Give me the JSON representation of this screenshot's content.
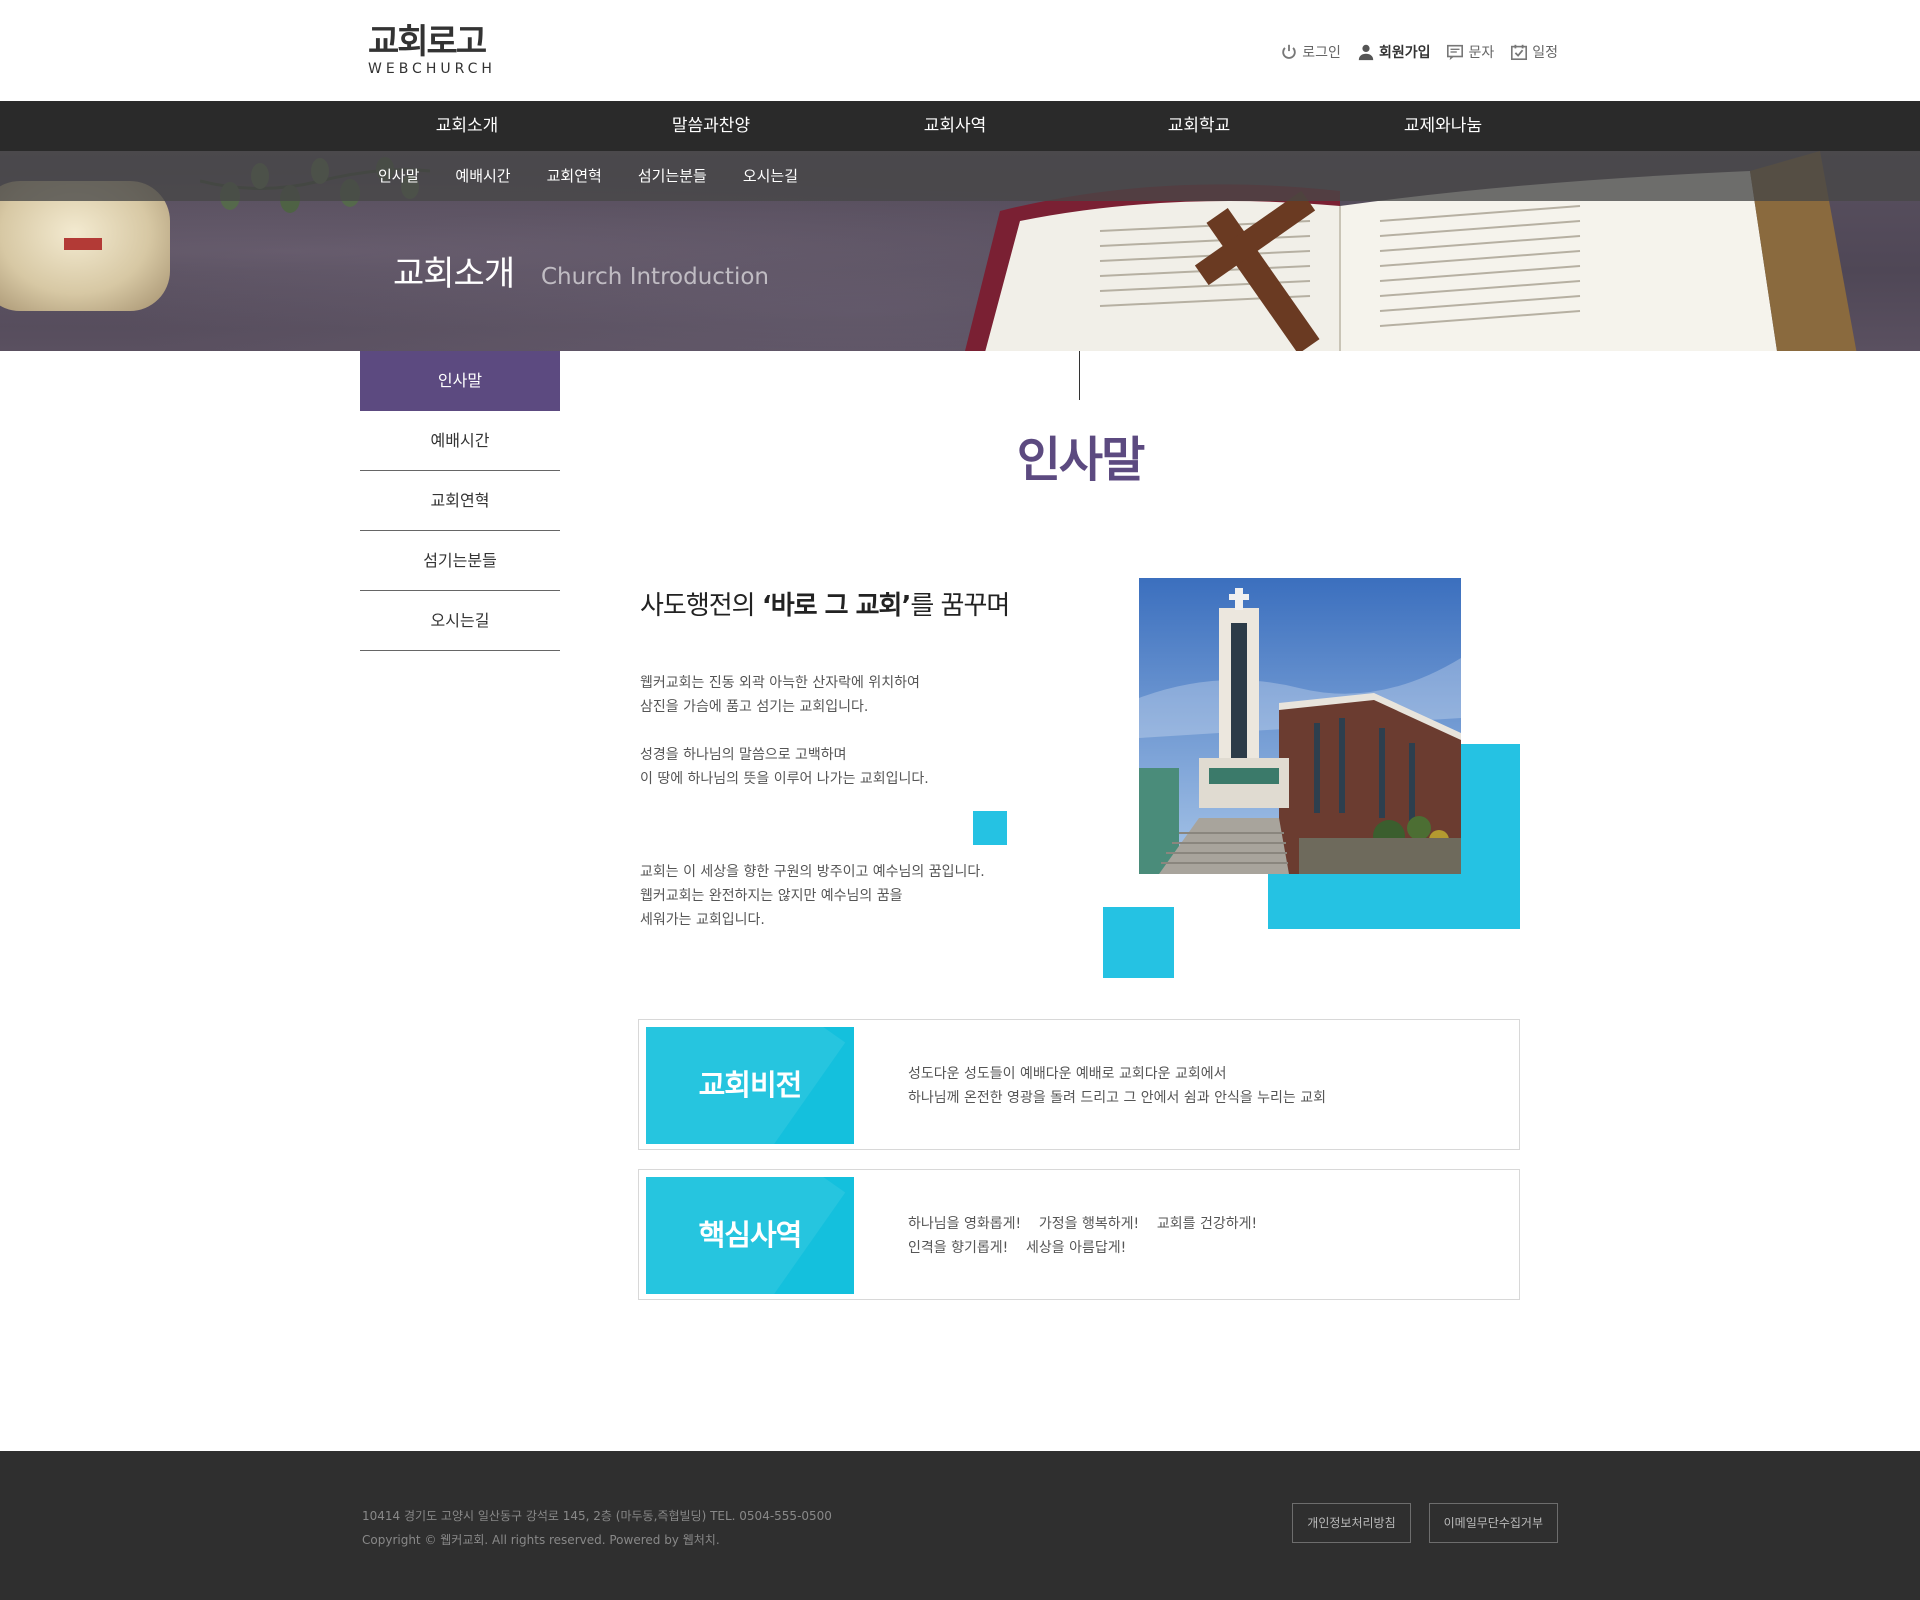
{
  "header": {
    "logo_title": "교회로고",
    "logo_sub": "WEBCHURCH",
    "util": [
      {
        "label": "로그인",
        "icon": "power-icon"
      },
      {
        "label": "회원가입",
        "icon": "user-icon"
      },
      {
        "label": "문자",
        "icon": "message-icon"
      },
      {
        "label": "일정",
        "icon": "calendar-check-icon"
      }
    ]
  },
  "gnb": [
    "교회소개",
    "말씀과찬양",
    "교회사역",
    "교회학교",
    "교제와나눔"
  ],
  "subnav": [
    "인사말",
    "예배시간",
    "교회연혁",
    "섬기는분들",
    "오시는길"
  ],
  "hero": {
    "title": "교회소개",
    "subtitle": "Church Introduction"
  },
  "lnb": [
    "인사말",
    "예배시간",
    "교회연혁",
    "섬기는분들",
    "오시는길"
  ],
  "content": {
    "page_title": "인사말",
    "head_pre": "사도행전의 ",
    "head_bold": "‘바로 그 교회’",
    "head_post": "를 꿈꾸며",
    "para1": [
      "웹커교회는 진동 외곽 아늑한 산자락에 위치하여",
      "삼진을 가슴에 품고 섬기는 교회입니다."
    ],
    "para2": [
      "성경을 하나님의 말씀으로 고백하며",
      "이 땅에 하나님의 뜻을 이루어 나가는 교회입니다."
    ],
    "para3": [
      "교회는 이 세상을 향한 구원의 방주이고 예수님의 꿈입니다.",
      "웹커교회는 완전하지는 않지만 예수님의 꿈을",
      "세워가는 교회입니다."
    ]
  },
  "boxes": [
    {
      "label": "교회비전",
      "lines": [
        "성도다운 성도들이 예배다운 예배로 교회다운 교회에서",
        "하나님께 온전한 영광을 돌려 드리고 그 안에서 쉼과 안식을 누리는 교회"
      ]
    },
    {
      "label": "핵심사역",
      "lines": [
        "하나님을 영화롭게!    가정을 행복하게!    교회를 건강하게!",
        "인격을 향기롭게!    세상을 아름답게!"
      ]
    }
  ],
  "footer": {
    "address": "10414 경기도 고양시 일산동구 강석로 145, 2층 (마두동,즉협빌딩) TEL. 0504-555-0500",
    "copyright": "Copyright © 웹커교회. All rights reserved. Powered by 웹처치.",
    "buttons": [
      "개인정보처리방침",
      "이메일무단수집거부"
    ]
  },
  "colors": {
    "accent_purple": "#5c4a80",
    "accent_cyan": "#25c2e3",
    "gnb_bg": "#2a2a2a",
    "footer_bg": "#2f2f2f"
  }
}
